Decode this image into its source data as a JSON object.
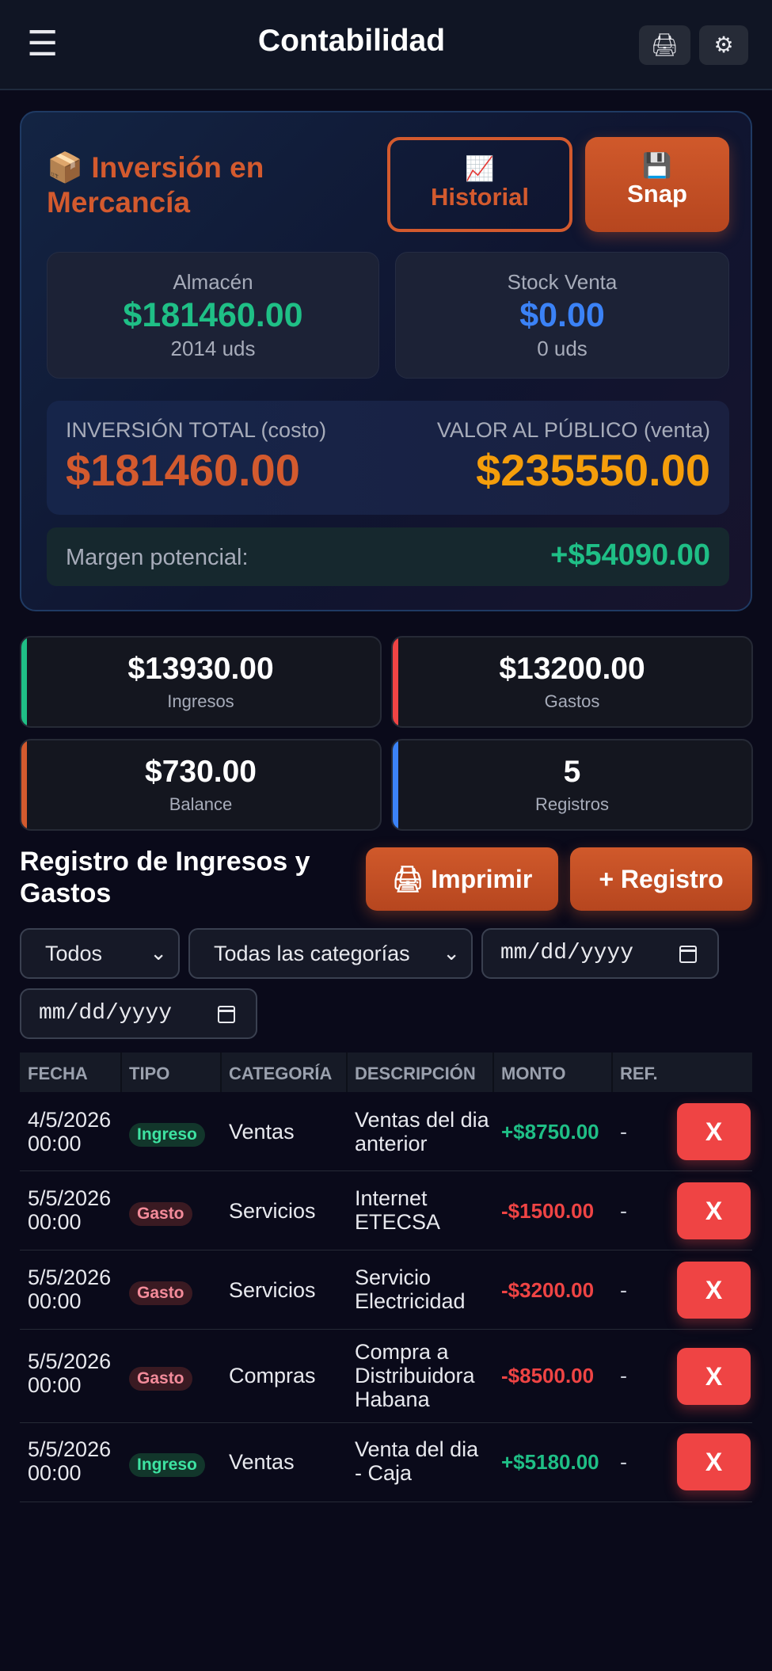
{
  "header": {
    "menu_icon": "☰",
    "title": "Contabilidad",
    "print_icon": "🖨",
    "settings_icon": "⚙"
  },
  "inventory": {
    "title_icon": "📦",
    "title": "Inversión en Mercancía",
    "historial_icon": "📈",
    "historial_label": "Historial",
    "snap_icon": "💾",
    "snap_label": "Snap",
    "almacen": {
      "label": "Almacén",
      "value": "$181460.00",
      "units": "2014 uds"
    },
    "stock_venta": {
      "label": "Stock Venta",
      "value": "$0.00",
      "units": "0 uds"
    },
    "inversion_total": {
      "label": "INVERSIÓN TOTAL (costo)",
      "value": "$181460.00"
    },
    "valor_publico": {
      "label": "VALOR AL PÚBLICO (venta)",
      "value": "$235550.00"
    },
    "margen": {
      "label": "Margen potencial:",
      "value": "+$54090.00"
    }
  },
  "summary": [
    {
      "value": "$13930.00",
      "label": "Ingresos",
      "color": "#1fbf86"
    },
    {
      "value": "$13200.00",
      "label": "Gastos",
      "color": "#ef4444"
    },
    {
      "value": "$730.00",
      "label": "Balance",
      "color": "#d35a2e"
    },
    {
      "value": "5",
      "label": "Registros",
      "color": "#3b82f6"
    }
  ],
  "registro": {
    "title": "Registro de Ingresos y Gastos",
    "print_icon": "🖨",
    "print_label": "Imprimir",
    "add_label": "+ Registro"
  },
  "filters": {
    "tipo": "Todos",
    "categoria": "Todas las categorías",
    "fecha_desde": "mm/dd/yyyy",
    "fecha_hasta": "mm/dd/yyyy"
  },
  "table": {
    "columns": [
      "FECHA",
      "TIPO",
      "CATEGORÍA",
      "DESCRIPCIÓN",
      "MONTO",
      "REF."
    ],
    "delete_label": "X",
    "rows": [
      {
        "fecha": "4/5/2026 00:00",
        "tipo": "Ingreso",
        "categoria": "Ventas",
        "descripcion": "Ventas del dia anterior",
        "monto": "+$8750.00",
        "ref": "-"
      },
      {
        "fecha": "5/5/2026 00:00",
        "tipo": "Gasto",
        "categoria": "Servicios",
        "descripcion": "Internet ETECSA",
        "monto": "-$1500.00",
        "ref": "-"
      },
      {
        "fecha": "5/5/2026 00:00",
        "tipo": "Gasto",
        "categoria": "Servicios",
        "descripcion": "Servicio Electricidad",
        "monto": "-$3200.00",
        "ref": "-"
      },
      {
        "fecha": "5/5/2026 00:00",
        "tipo": "Gasto",
        "categoria": "Compras",
        "descripcion": "Compra a Distribuidora Habana",
        "monto": "-$8500.00",
        "ref": "-"
      },
      {
        "fecha": "5/5/2026 00:00",
        "tipo": "Ingreso",
        "categoria": "Ventas",
        "descripcion": "Venta del dia - Caja",
        "monto": "+$5180.00",
        "ref": "-"
      }
    ]
  }
}
